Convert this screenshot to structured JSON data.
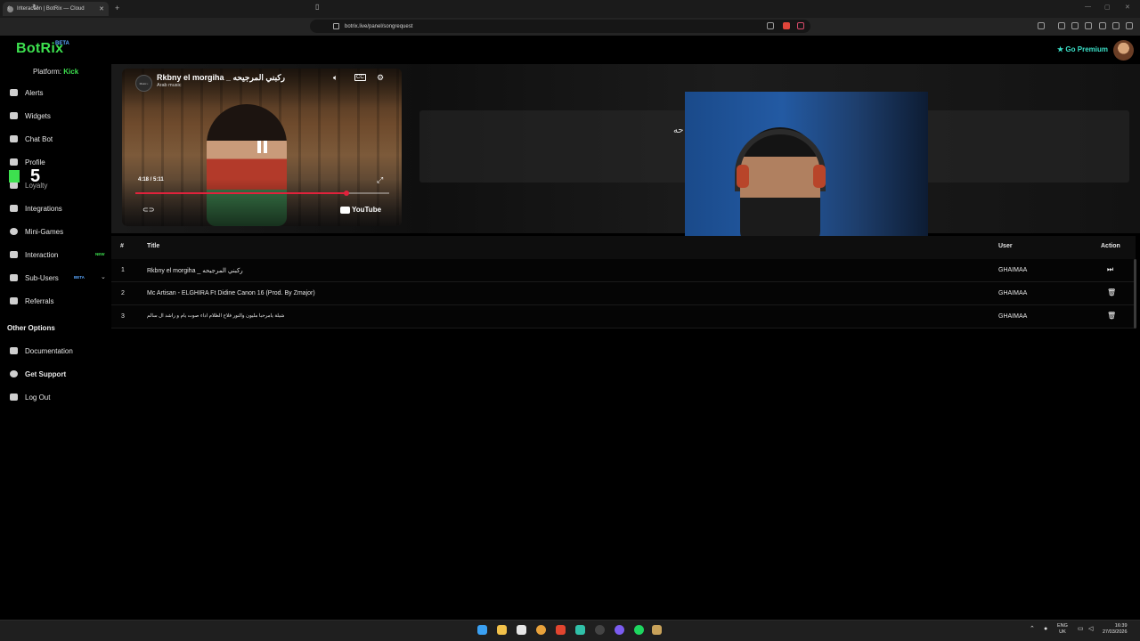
{
  "browser": {
    "tab_title": "Interaction | BotRix — Cloud",
    "tab_close": "✕",
    "new_tab": "+",
    "url": "botrix.live/panel/songrequest",
    "win_min": "—",
    "win_max": "▢",
    "win_close": "✕"
  },
  "brand": {
    "name": "BotRix",
    "beta": "BETA",
    "platform_label": "Platform:",
    "platform_value": "Kick"
  },
  "sidebar": {
    "items": [
      {
        "label": "Alerts"
      },
      {
        "label": "Widgets"
      },
      {
        "label": "Chat Bot"
      },
      {
        "label": "Profile"
      },
      {
        "label": "Loyalty"
      },
      {
        "label": "Integrations"
      },
      {
        "label": "Mini-Games"
      },
      {
        "label": "Interaction",
        "badge": "NEW"
      },
      {
        "label": "Sub-Users",
        "badge": "BETA"
      },
      {
        "label": "Referrals"
      }
    ],
    "other_title": "Other Options",
    "other_items": [
      {
        "label": "Documentation"
      },
      {
        "label": "Get Support"
      },
      {
        "label": "Log Out"
      }
    ]
  },
  "overlay": {
    "kick_count": "5"
  },
  "header": {
    "premium_label": "Go Premium"
  },
  "player": {
    "channel_badge": "Music •",
    "title": "Rkbny el morgiha _ ركبني المرجيحه",
    "subtitle": "Arab music",
    "time": "4:18 / 5:11",
    "progress_fraction": 0.83,
    "youtube_label": "YouTube",
    "info_text": "حه"
  },
  "table": {
    "headers": {
      "num": "#",
      "title": "Title",
      "user": "User",
      "action": "Action"
    },
    "rows": [
      {
        "num": "1",
        "title": "Rkbny el morgiha _ ركبني المرجيحه",
        "user": "GHAIMAA",
        "action": "skip"
      },
      {
        "num": "2",
        "title": "Mc Artisan - ELGHIRA Ft Didine Canon 16 (Prod. By Zmajor)",
        "user": "GHAIMAA",
        "action": "delete"
      },
      {
        "num": "3",
        "title": "شيلة يامرحبا مليون والنور فلاح الظلام اداء صوت يام و راشد ال سالم",
        "user": "GHAIMAA",
        "action": "delete"
      }
    ]
  },
  "tray": {
    "lang": "ENG",
    "region": "UK",
    "time": "16:39",
    "date": "27/03/2026"
  }
}
